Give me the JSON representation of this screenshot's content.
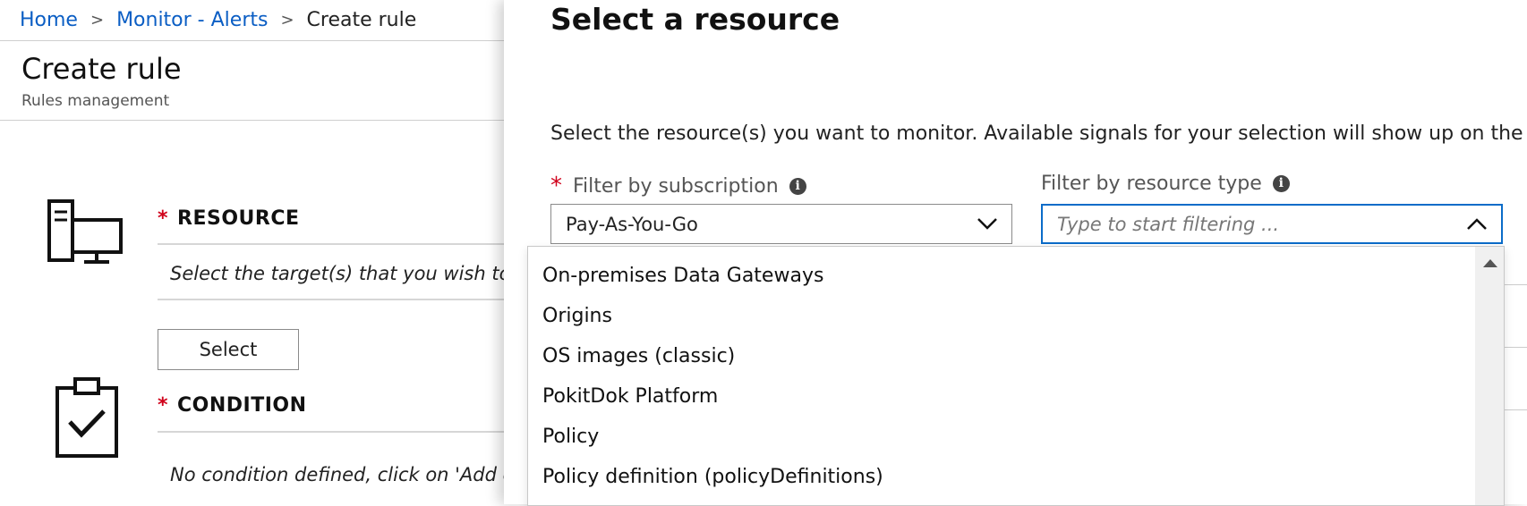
{
  "breadcrumb": {
    "items": [
      "Home",
      "Monitor - Alerts"
    ],
    "current": "Create rule",
    "separator": ">"
  },
  "page": {
    "title": "Create rule",
    "subtitle": "Rules management"
  },
  "resource_section": {
    "label": "RESOURCE",
    "required_mark": "*",
    "description": "Select the target(s) that you wish to monitor",
    "select_button": "Select",
    "icon": "computer-devices-icon"
  },
  "condition_section": {
    "label": "CONDITION",
    "required_mark": "*",
    "description": "No condition defined, click on 'Add condition'",
    "icon": "clipboard-check-icon"
  },
  "blade": {
    "title": "Select a resource",
    "description": "Select the resource(s) you want to monitor. Available signals for your selection will show up on the",
    "subscription": {
      "label": "Filter by subscription",
      "required_mark": "*",
      "value": "Pay-As-You-Go"
    },
    "resource_type": {
      "label": "Filter by resource type",
      "placeholder": "Type to start filtering ..."
    },
    "dropdown_options": [
      "On-premises Data Gateways",
      "Origins",
      "OS images (classic)",
      "PokitDok Platform",
      "Policy",
      "Policy definition (policyDefinitions)"
    ]
  },
  "colors": {
    "link": "#0b5ec4",
    "required": "#d0021b",
    "focus_border": "#0b6cc9"
  }
}
